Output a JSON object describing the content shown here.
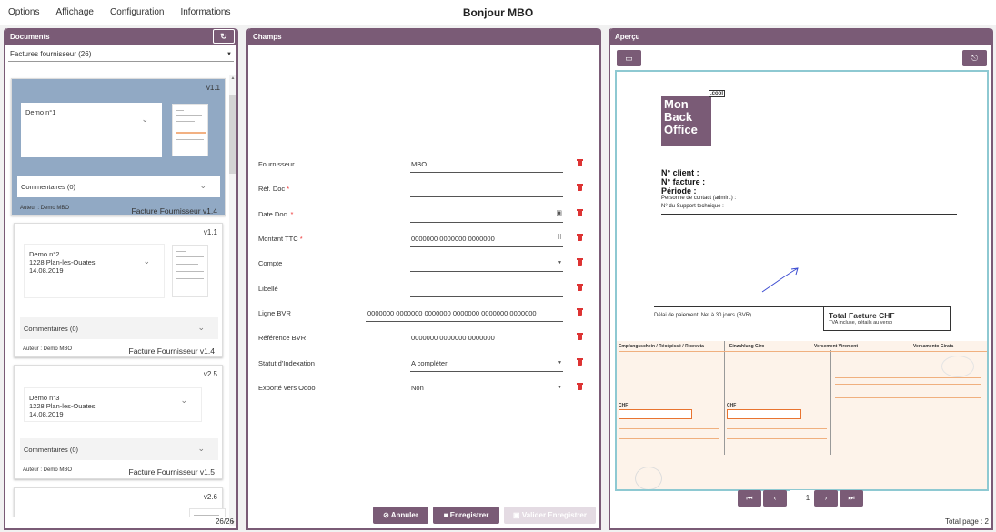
{
  "menu": [
    "Options",
    "Affichage",
    "Configuration",
    "Informations"
  ],
  "title": "Bonjour MBO",
  "documents": {
    "header": "Documents",
    "filter": "Factures fournisseur (26)",
    "count": "26/26",
    "cards": [
      {
        "version": "v1.1",
        "name_lines": [
          "Demo n°1"
        ],
        "comments": "Commentaires (0)",
        "author": "Auteur : Demo MBO",
        "type": "Facture Fournisseur v1.4",
        "active": true
      },
      {
        "version": "v1.1",
        "name_lines": [
          "Demo n°2",
          "1228 Plan-les-Ouates",
          "14.08.2019"
        ],
        "comments": "Commentaires (0)",
        "author": "Auteur : Demo MBO",
        "type": "Facture Fournisseur v1.4",
        "active": false
      },
      {
        "version": "v2.5",
        "name_lines": [
          "Demo n°3",
          "1228 Plan-les-Ouates",
          "14.08.2019"
        ],
        "comments": "Commentaires (0)",
        "author": "Auteur : Demo MBO",
        "type": "Facture Fournisseur v1.5",
        "active": false
      },
      {
        "version": "v2.6",
        "name_lines": [],
        "comments": "",
        "author": "",
        "type": "",
        "active": false
      }
    ]
  },
  "champs": {
    "header": "Champs",
    "fields": [
      {
        "label": "Fournisseur",
        "required": false,
        "value": "MBO",
        "suffix": ""
      },
      {
        "label": "Réf. Doc",
        "required": true,
        "value": "",
        "suffix": ""
      },
      {
        "label": "Date Doc.",
        "required": true,
        "value": "",
        "suffix": "calendar"
      },
      {
        "label": "Montant TTC",
        "required": true,
        "value": "0000000 0000000 0000000",
        "suffix": "keypad"
      },
      {
        "label": "Compte",
        "required": false,
        "value": "",
        "suffix": "caret"
      },
      {
        "label": "Libellé",
        "required": false,
        "value": "",
        "suffix": ""
      },
      {
        "label": "Ligne BVR",
        "required": false,
        "value": "0000000 0000000 0000000 0000000 0000000 0000000",
        "suffix": ""
      },
      {
        "label": "Référence BVR",
        "required": false,
        "value": "0000000 0000000 0000000",
        "suffix": ""
      },
      {
        "label": "Statut d'Indexation",
        "required": false,
        "value": "A compléter",
        "suffix": "caret"
      },
      {
        "label": "Exporté vers Odoo",
        "required": false,
        "value": "Non",
        "suffix": "caret"
      }
    ],
    "buttons": {
      "cancel": "Annuler",
      "save": "Enregistrer",
      "validate": "Valider Enregistrer"
    }
  },
  "apercu": {
    "header": "Aperçu",
    "logo": {
      "line1": "Mon",
      "line2": "Back",
      "line3": "Office",
      "badge": ".cool"
    },
    "client_no": "N° client :",
    "invoice_no": "N° facture :",
    "period": "Période :",
    "contact": "Personne de contact (admin.) :",
    "support": "N° du Support technique :",
    "payment": "Délai de paiement: Net à 30 jours (BVR)",
    "total_title": "Total Facture CHF",
    "total_sub": "TVA incluse, détails au verso",
    "slip_headers": [
      "Empfangsschein / Récépissé / Ricevuta",
      "Einzahlung Giro",
      "Versement Virement",
      "Versamento Girata"
    ],
    "slip_chf": [
      "CHF",
      "CHF"
    ],
    "pager": {
      "page": "1",
      "total": "Total page : 2"
    }
  }
}
